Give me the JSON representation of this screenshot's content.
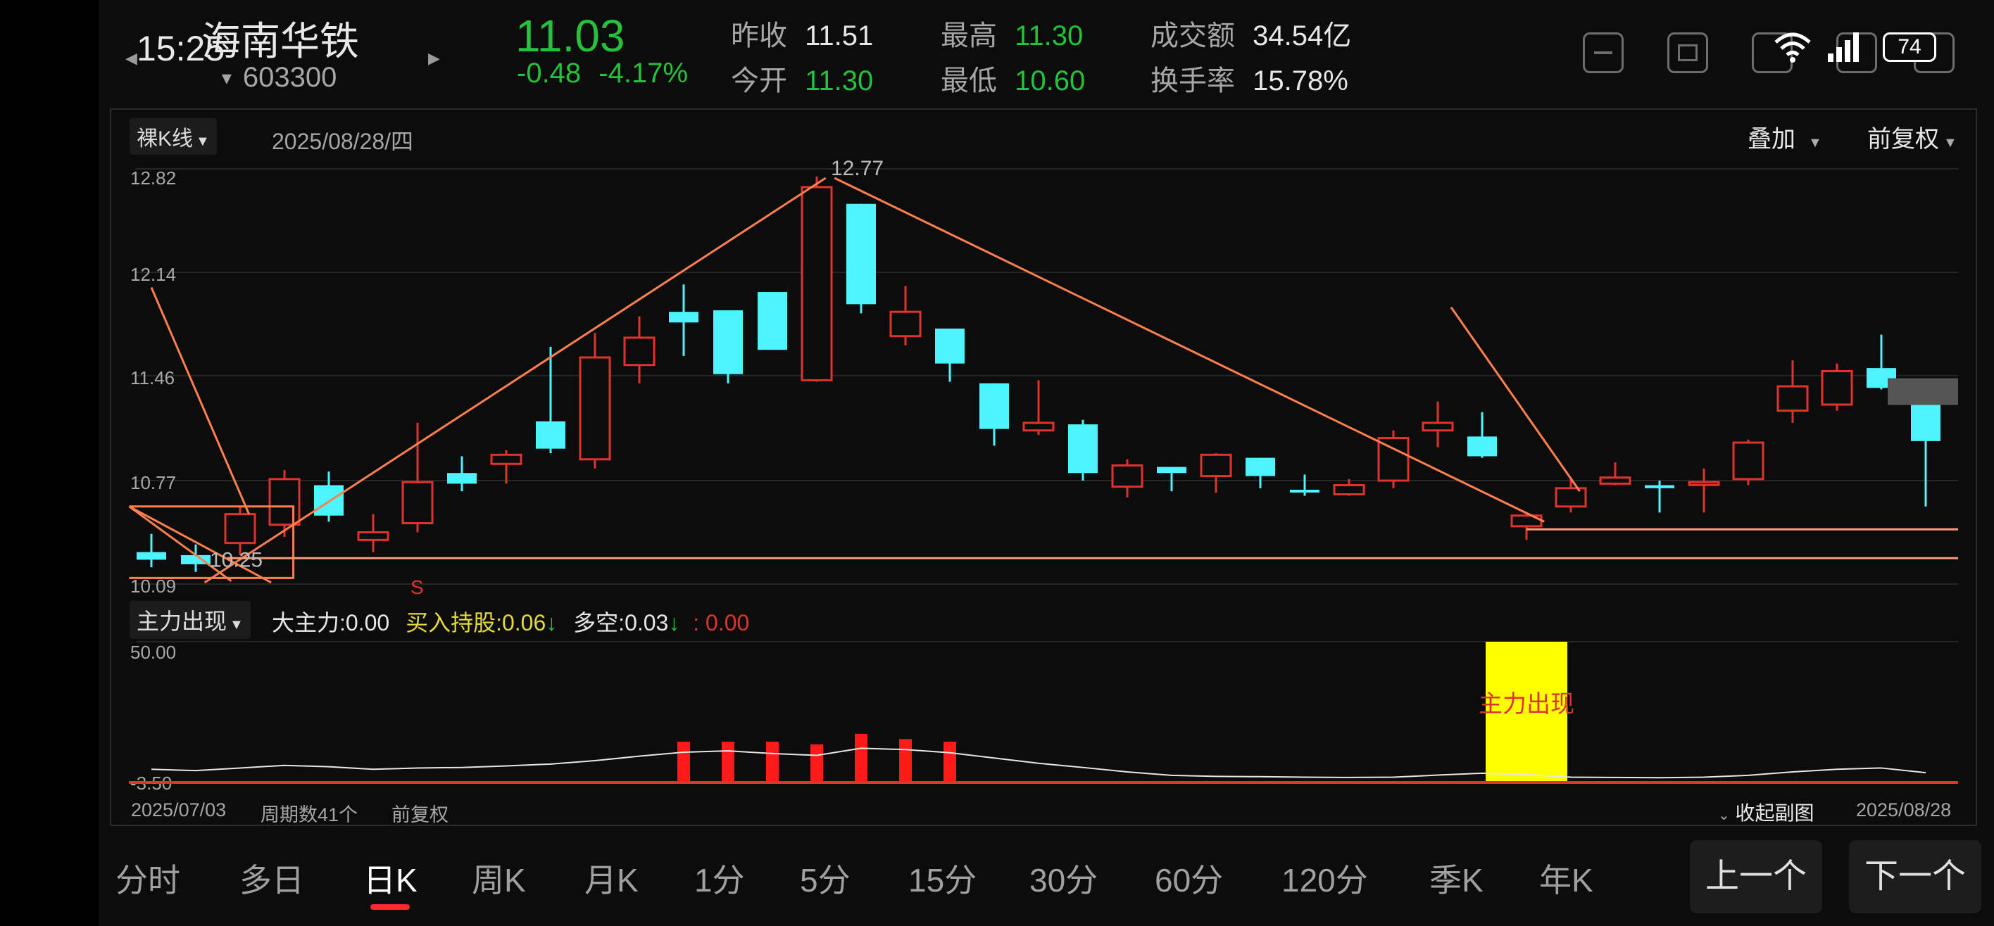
{
  "status": {
    "time": "15:25",
    "battery": "74"
  },
  "stock": {
    "name": "海南华铁",
    "code": "603300",
    "price": "11.03",
    "change": "-0.48",
    "change_pct": "-4.17%"
  },
  "quote": {
    "prev_close_label": "昨收",
    "prev_close": "11.51",
    "open_label": "今开",
    "open": "11.30",
    "high_label": "最高",
    "high": "11.30",
    "low_label": "最低",
    "low": "10.60",
    "amount_label": "成交额",
    "amount": "34.54亿",
    "turnover_label": "换手率",
    "turnover": "15.78%"
  },
  "chart_toolbar": {
    "kline_mode": "裸K线",
    "date": "2025/08/28/四",
    "overlay": "叠加",
    "adjust": "前复权"
  },
  "indicator_bar": {
    "name": "主力出现",
    "main_force_label": "大主力:",
    "main_force_value": "0.00",
    "hold_label": "买入持股:",
    "hold_value": "0.06",
    "long_short_label": "多空:",
    "long_short_value": "0.03",
    "extra_value": ": 0.00"
  },
  "footer": {
    "start_date": "2025/07/03",
    "period": "周期数41个",
    "adjust": "前复权",
    "collapse": "收起副图",
    "end_date": "2025/08/28"
  },
  "timeframes": [
    "分时",
    "多日",
    "日K",
    "周K",
    "月K",
    "1分",
    "5分",
    "15分",
    "30分",
    "60分",
    "120分",
    "季K",
    "年K"
  ],
  "active_timeframe": "日K",
  "nav": {
    "prev": "上一个",
    "next": "下一个"
  },
  "colors": {
    "up": "#e0332e",
    "down": "#4cf4ff",
    "trend": "#ff7f4f",
    "highlight": "#ffff00"
  },
  "chart_data": [
    {
      "type": "candlestick",
      "yticks": [
        12.82,
        12.14,
        11.46,
        10.77,
        10.09
      ],
      "ylim": [
        10.09,
        12.82
      ],
      "annotations": [
        "12.77",
        "10.25",
        "S"
      ],
      "candles": [
        {
          "o": 10.3,
          "h": 10.42,
          "l": 10.2,
          "c": 10.25
        },
        {
          "o": 10.28,
          "h": 10.35,
          "l": 10.17,
          "c": 10.22
        },
        {
          "o": 10.36,
          "h": 10.6,
          "l": 10.28,
          "c": 10.55
        },
        {
          "o": 10.48,
          "h": 10.84,
          "l": 10.4,
          "c": 10.78
        },
        {
          "o": 10.74,
          "h": 10.83,
          "l": 10.5,
          "c": 10.54
        },
        {
          "o": 10.38,
          "h": 10.55,
          "l": 10.3,
          "c": 10.43
        },
        {
          "o": 10.49,
          "h": 11.15,
          "l": 10.43,
          "c": 10.76
        },
        {
          "o": 10.82,
          "h": 10.93,
          "l": 10.7,
          "c": 10.75
        },
        {
          "o": 10.88,
          "h": 10.97,
          "l": 10.75,
          "c": 10.94
        },
        {
          "o": 11.16,
          "h": 11.65,
          "l": 10.95,
          "c": 10.98
        },
        {
          "o": 10.91,
          "h": 11.74,
          "l": 10.85,
          "c": 11.58
        },
        {
          "o": 11.53,
          "h": 11.85,
          "l": 11.41,
          "c": 11.71
        },
        {
          "o": 11.88,
          "h": 12.06,
          "l": 11.59,
          "c": 11.81
        },
        {
          "o": 11.89,
          "h": 11.89,
          "l": 11.41,
          "c": 11.47
        },
        {
          "o": 12.01,
          "h": 12.01,
          "l": 11.65,
          "c": 11.63
        },
        {
          "o": 11.43,
          "h": 12.77,
          "l": 11.42,
          "c": 12.7
        },
        {
          "o": 12.59,
          "h": 12.59,
          "l": 11.87,
          "c": 11.93
        },
        {
          "o": 11.72,
          "h": 12.05,
          "l": 11.66,
          "c": 11.88
        },
        {
          "o": 11.77,
          "h": 11.77,
          "l": 11.42,
          "c": 11.54
        },
        {
          "o": 11.41,
          "h": 11.41,
          "l": 11.0,
          "c": 11.11
        },
        {
          "o": 11.1,
          "h": 11.43,
          "l": 11.07,
          "c": 11.15
        },
        {
          "o": 11.14,
          "h": 11.17,
          "l": 10.77,
          "c": 10.82
        },
        {
          "o": 10.73,
          "h": 10.91,
          "l": 10.66,
          "c": 10.87
        },
        {
          "o": 10.86,
          "h": 10.86,
          "l": 10.7,
          "c": 10.82
        },
        {
          "o": 10.8,
          "h": 10.95,
          "l": 10.69,
          "c": 10.94
        },
        {
          "o": 10.92,
          "h": 10.92,
          "l": 10.72,
          "c": 10.8
        },
        {
          "o": 10.71,
          "h": 10.81,
          "l": 10.67,
          "c": 10.7
        },
        {
          "o": 10.68,
          "h": 10.78,
          "l": 10.67,
          "c": 10.74
        },
        {
          "o": 10.77,
          "h": 11.1,
          "l": 10.72,
          "c": 11.05
        },
        {
          "o": 11.1,
          "h": 11.29,
          "l": 10.99,
          "c": 11.15
        },
        {
          "o": 11.06,
          "h": 11.22,
          "l": 10.92,
          "c": 10.93
        },
        {
          "o": 10.47,
          "h": 10.55,
          "l": 10.38,
          "c": 10.54
        },
        {
          "o": 10.6,
          "h": 10.79,
          "l": 10.56,
          "c": 10.72
        },
        {
          "o": 10.75,
          "h": 10.89,
          "l": 10.74,
          "c": 10.79
        },
        {
          "o": 10.74,
          "h": 10.77,
          "l": 10.56,
          "c": 10.72
        },
        {
          "o": 10.75,
          "h": 10.85,
          "l": 10.56,
          "c": 10.76
        },
        {
          "o": 10.78,
          "h": 11.04,
          "l": 10.74,
          "c": 11.02
        },
        {
          "o": 11.23,
          "h": 11.56,
          "l": 11.15,
          "c": 11.39
        },
        {
          "o": 11.27,
          "h": 11.54,
          "l": 11.23,
          "c": 11.49
        },
        {
          "o": 11.51,
          "h": 11.73,
          "l": 11.37,
          "c": 11.38
        },
        {
          "o": 11.3,
          "h": 11.3,
          "l": 10.6,
          "c": 11.03
        }
      ]
    },
    {
      "type": "bar",
      "name": "主力出现",
      "yticks": [
        50.0,
        -3.5
      ],
      "ylim": [
        -3.5,
        50
      ],
      "bar_values": [
        0,
        0,
        0,
        0,
        0,
        0,
        0,
        0,
        0,
        0,
        0,
        0,
        12,
        12,
        12,
        11,
        15,
        13,
        12,
        0,
        0,
        0,
        0,
        0,
        0,
        0,
        0,
        0,
        0,
        0,
        0,
        0,
        0,
        0,
        0,
        0,
        0,
        0,
        0,
        0,
        0
      ],
      "highlight_bar": {
        "index": 31,
        "value": 50,
        "label": "主力出现"
      },
      "line_values": [
        1.5,
        1.0,
        2.0,
        3.0,
        2.5,
        1.5,
        2.0,
        2.2,
        2.8,
        3.5,
        4.8,
        6.5,
        8.0,
        8.5,
        7.5,
        6.8,
        9.5,
        9.0,
        7.8,
        5.8,
        3.8,
        2.2,
        0.5,
        -0.8,
        -1.2,
        -1.3,
        -1.5,
        -1.6,
        -1.5,
        -0.7,
        0,
        -0.5,
        -1.5,
        -1.6,
        -1.7,
        -1.5,
        -0.8,
        0.5,
        1.5,
        2.0,
        0.2
      ]
    }
  ]
}
